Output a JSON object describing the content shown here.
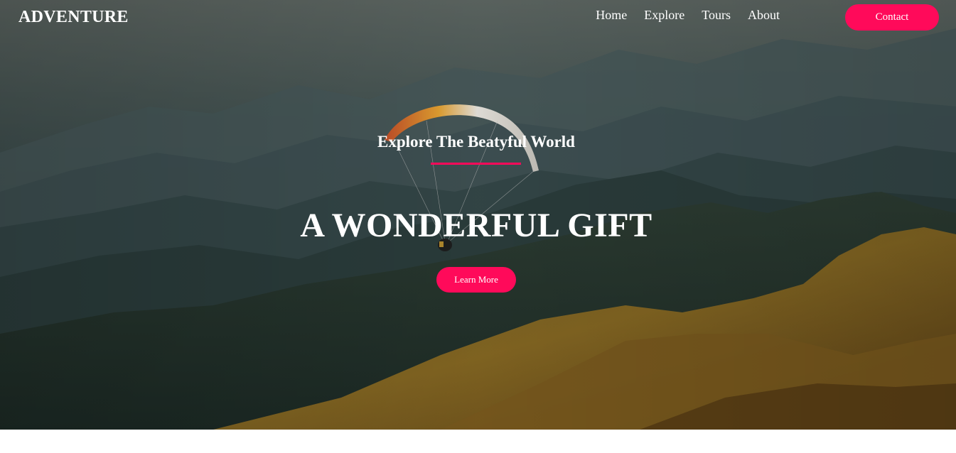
{
  "header": {
    "brand": "ADVENTURE",
    "nav": [
      {
        "label": "Home"
      },
      {
        "label": "Explore"
      },
      {
        "label": "Tours"
      },
      {
        "label": "About"
      }
    ],
    "contact_label": "Contact"
  },
  "hero": {
    "tagline": "Explore The Beatyful World",
    "headline": "A WONDERFUL GIFT",
    "cta_label": "Learn More"
  },
  "colors": {
    "accent": "#ff0a5a",
    "text": "#ffffff"
  }
}
